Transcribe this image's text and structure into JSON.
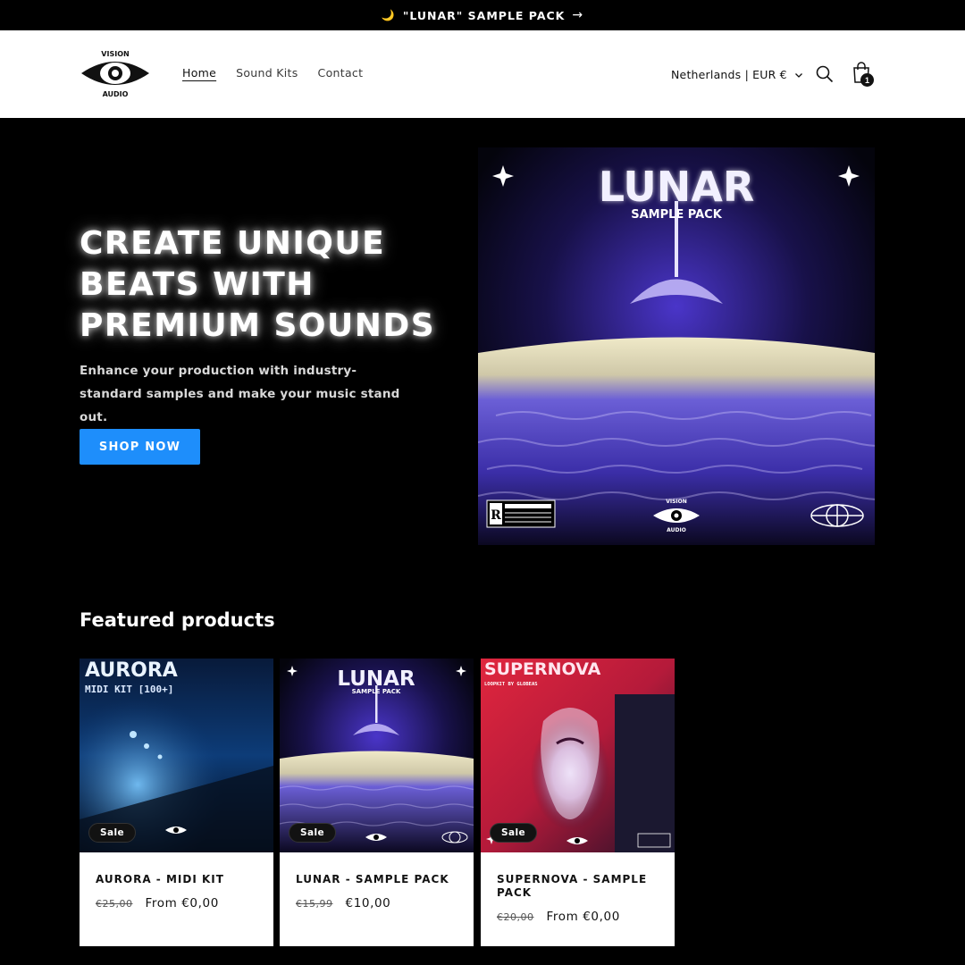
{
  "announcement": {
    "moon_icon": "crescent-moon-icon",
    "text": "\"LUNAR\" SAMPLE PACK",
    "arrow_icon": "arrow-right-icon"
  },
  "header": {
    "logo": {
      "top_text": "VISION",
      "bottom_text": "AUDIO"
    },
    "nav": [
      {
        "label": "Home",
        "active": true
      },
      {
        "label": "Sound Kits",
        "active": false
      },
      {
        "label": "Contact",
        "active": false
      }
    ],
    "locale": "Netherlands | EUR €",
    "cart_count": "1"
  },
  "hero": {
    "title": "CREATE UNIQUE\nBEATS WITH\nPREMIUM SOUNDS",
    "subtitle": "Enhance your production with industry-standard samples and make your music stand out.",
    "button": "SHOP NOW",
    "art": {
      "title": "LUNAR",
      "subtitle": "SAMPLE PACK",
      "logo_top": "VISION",
      "logo_bottom": "AUDIO"
    }
  },
  "featured": {
    "heading": "Featured products",
    "products": [
      {
        "name": "AURORA - MIDI KIT",
        "old_price": "€25,00",
        "price": "From €0,00",
        "badge": "Sale",
        "art_title": "AURORA",
        "art_subtitle": "MIDI KIT [100+]"
      },
      {
        "name": "LUNAR - SAMPLE PACK",
        "old_price": "€15,99",
        "price": "€10,00",
        "badge": "Sale",
        "art_title": "LUNAR",
        "art_subtitle": "SAMPLE PACK"
      },
      {
        "name": "SUPERNOVA - SAMPLE PACK",
        "old_price": "€20,00",
        "price": "From €0,00",
        "badge": "Sale",
        "art_title": "SUPERNOVA",
        "art_subtitle": "LOOPKIT BY GLOBEAS"
      }
    ]
  },
  "colors": {
    "accent": "#1e8efb",
    "background": "#000000",
    "header_bg": "#ffffff"
  }
}
